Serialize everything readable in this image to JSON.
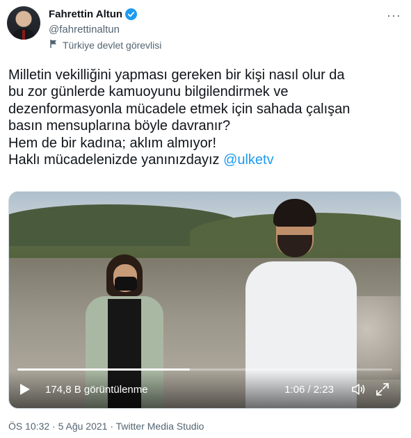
{
  "author": {
    "name": "Fahrettin Altun",
    "handle": "@fahrettinaltun",
    "label": "Türkiye devlet görevlisi",
    "avatar_icon": "avatar-portrait",
    "verified_icon": "verified-badge-icon"
  },
  "tweet": {
    "lines": [
      "Milletin vekilliğini yapması gereken bir kişi nasıl olur da",
      "bu zor günlerde kamuoyunu bilgilendirmek ve",
      "dezenformasyonla mücadele etmek için sahada çalışan",
      "basın mensuplarına böyle davranır?",
      "Hem de bir kadına; aklım almıyor!",
      "Haklı mücadelenizde yanınızdayız"
    ],
    "mention": "@ulketv"
  },
  "video": {
    "views": "174,8 B görüntülenme",
    "time": "1:06 / 2:23",
    "progress": 0.46,
    "icons": [
      "play-icon",
      "volume-icon",
      "fullscreen-icon"
    ]
  },
  "meta": {
    "timestamp": "ÖS 10:32 · 5 Ağu 2021 · Twitter Media Studio"
  },
  "colors": {
    "accent": "#1d9bf0",
    "text": "#0f1419",
    "secondary": "#536471"
  }
}
